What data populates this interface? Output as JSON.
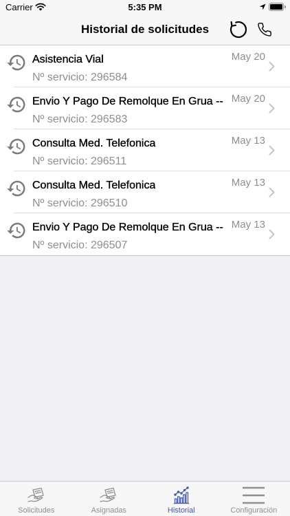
{
  "status_bar": {
    "carrier": "Carrier",
    "time": "5:35 PM",
    "battery_level": 1.0,
    "icons": [
      "wifi-icon",
      "location-arrow-icon",
      "battery-icon"
    ]
  },
  "nav": {
    "title": "Historial de solicitudes",
    "actions": [
      {
        "icon": "refresh-icon"
      },
      {
        "icon": "phone-icon"
      }
    ]
  },
  "requests": [
    {
      "title": "Asistencia Vial",
      "service": "Nº servicio: 296584",
      "date": "May 20",
      "icon": "history-icon"
    },
    {
      "title": "Envio Y Pago De Remolque En Grua --",
      "service": "Nº servicio: 296583",
      "date": "May 20",
      "icon": "history-icon"
    },
    {
      "title": "Consulta Med. Telefonica",
      "service": "Nº servicio: 296511",
      "date": "May 13",
      "icon": "history-icon"
    },
    {
      "title": "Consulta Med. Telefonica",
      "service": "Nº servicio: 296510",
      "date": "May 13",
      "icon": "history-icon"
    },
    {
      "title": "Envio Y Pago De Remolque En Grua --",
      "service": "Nº servicio: 296507",
      "date": "May 13",
      "icon": "history-icon"
    }
  ],
  "tabs": [
    {
      "label": "Solicitudes",
      "icon": "hand-card-icon",
      "active": false
    },
    {
      "label": "Asignadas",
      "icon": "hand-card-icon",
      "active": false
    },
    {
      "label": "Historial",
      "icon": "bar-chart-icon",
      "active": true
    },
    {
      "label": "Configuración",
      "icon": "menu-icon",
      "active": false
    }
  ],
  "colors": {
    "accent": "#3f55b3",
    "inactive": "#8e8e93",
    "secondary_text": "#8e8e93",
    "background": "#efeff4",
    "bar_background": "#f7f7f7",
    "separator": "#c8c7cc",
    "icon_gray": "#7b7b7b",
    "chevron": "#c4c4c9"
  }
}
